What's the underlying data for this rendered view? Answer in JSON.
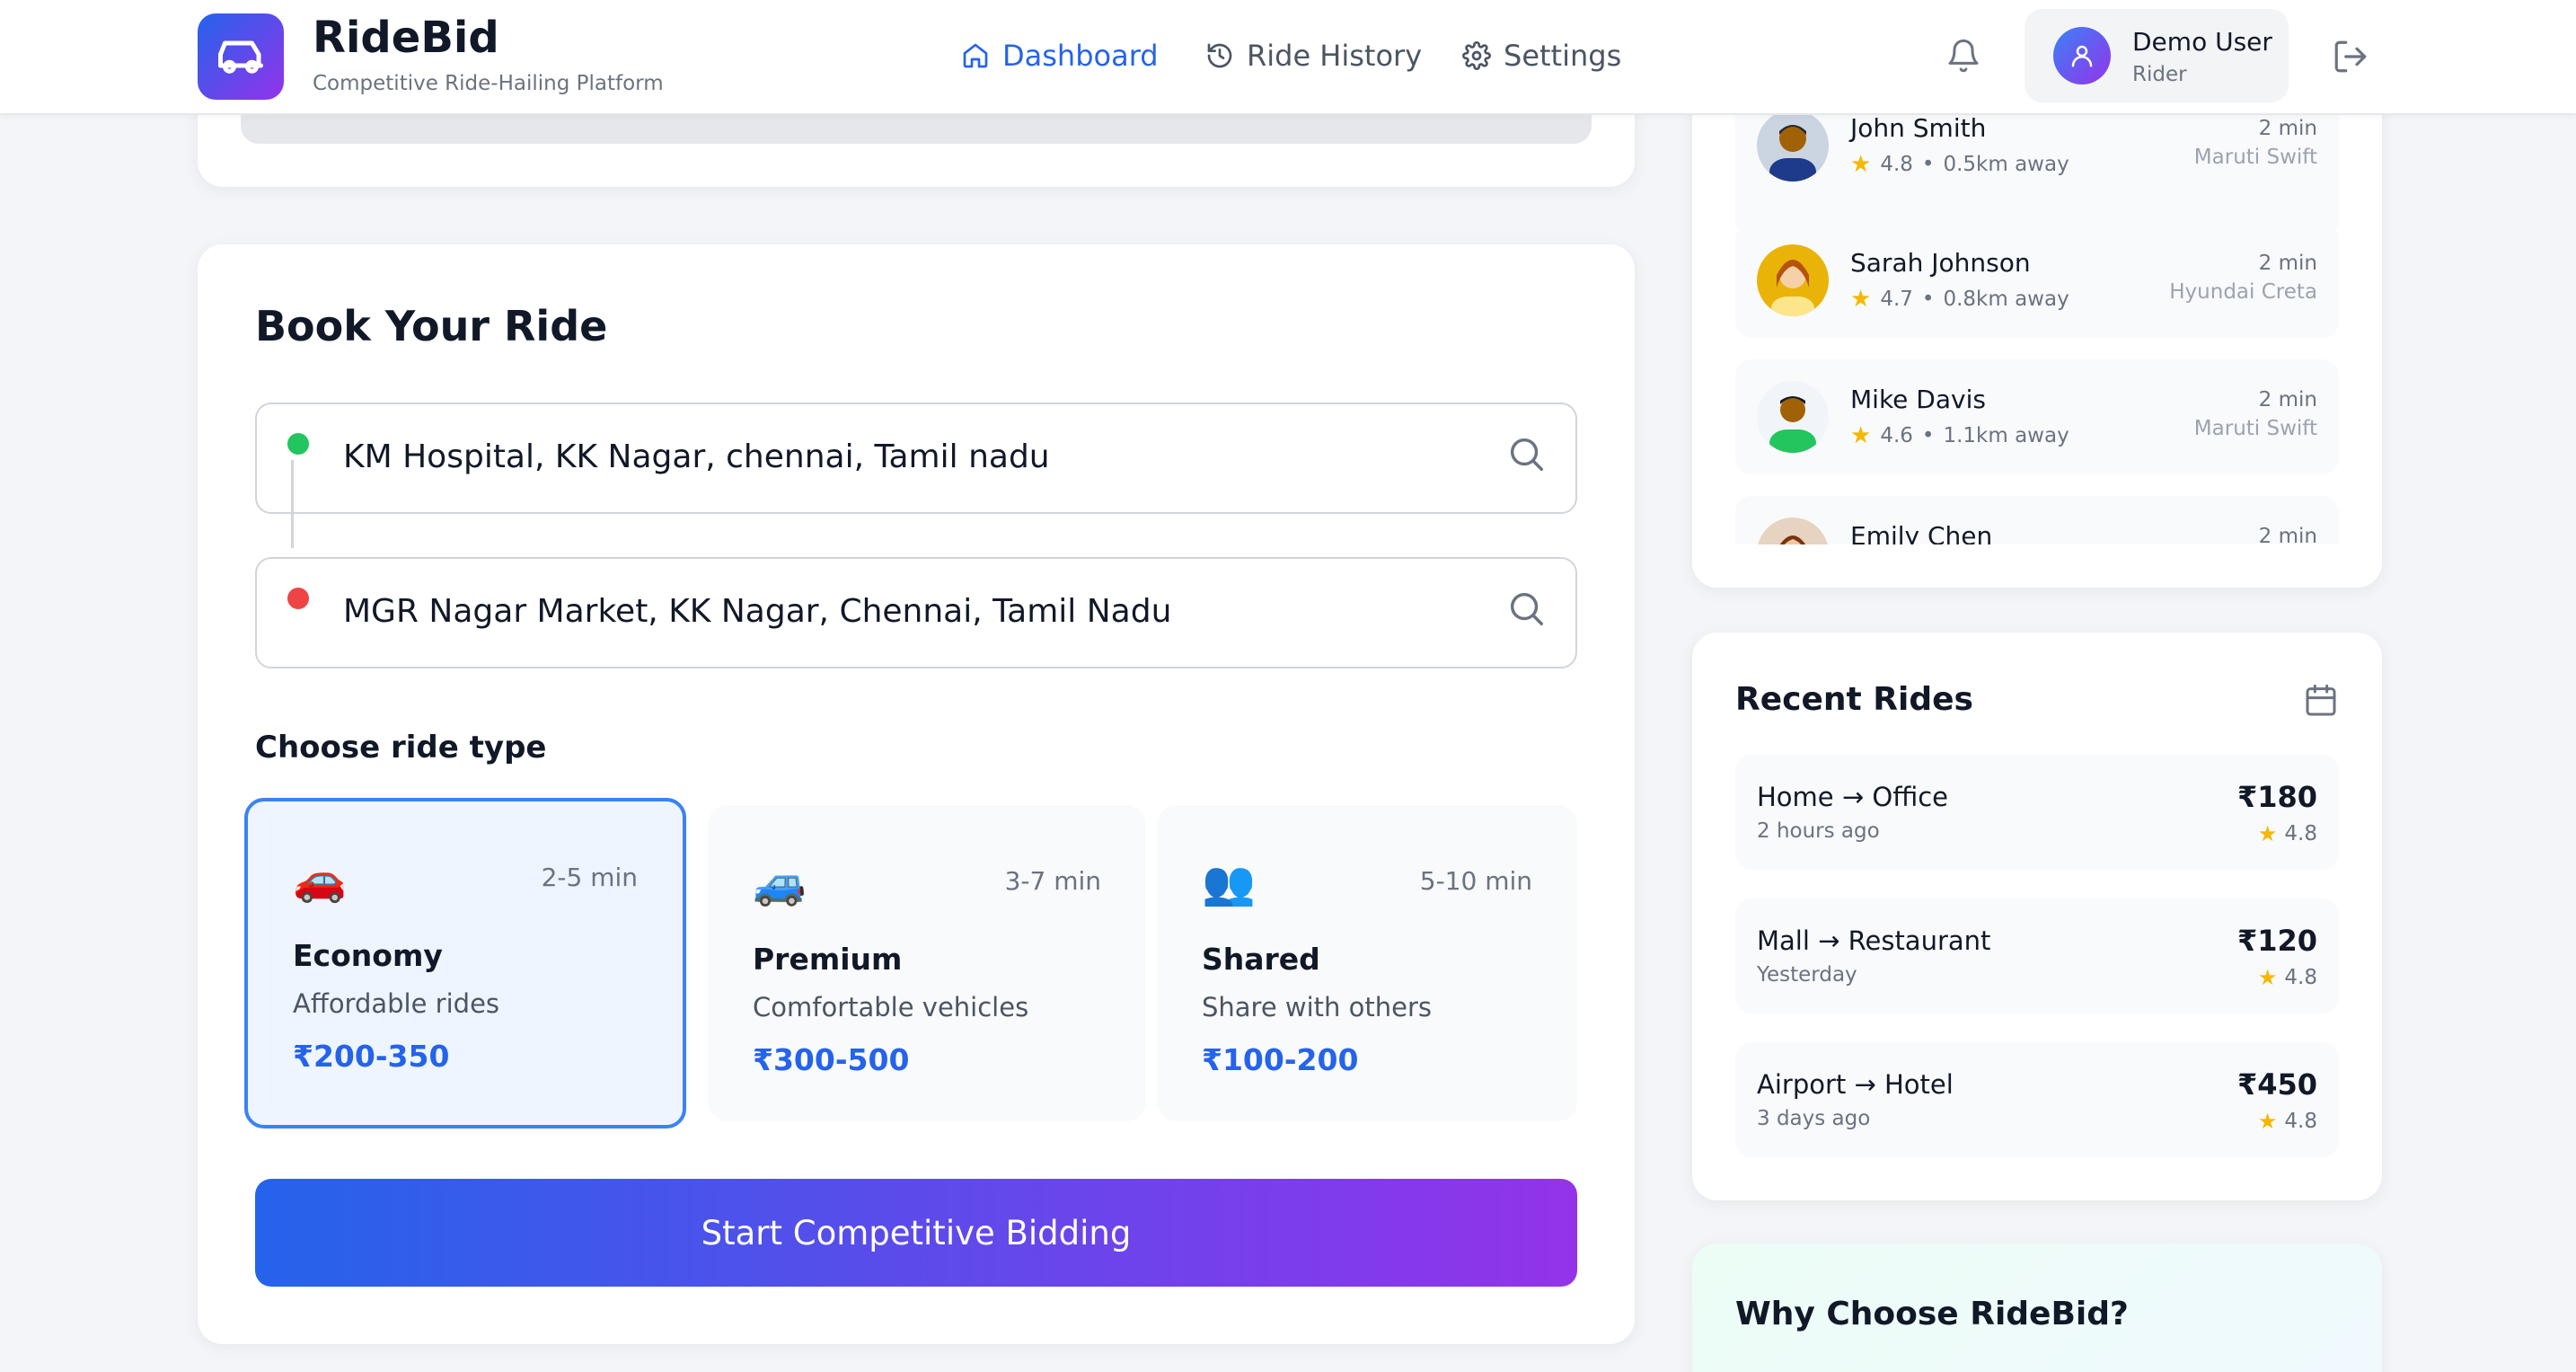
{
  "header": {
    "brand": "RideBid",
    "tagline": "Competitive Ride-Hailing Platform",
    "nav": [
      {
        "label": "Dashboard",
        "icon": "home-icon",
        "active": true
      },
      {
        "label": "Ride History",
        "icon": "history-icon",
        "active": false
      },
      {
        "label": "Settings",
        "icon": "gear-icon",
        "active": false
      }
    ],
    "user": {
      "name": "Demo User",
      "role": "Rider"
    }
  },
  "booking": {
    "title": "Book Your Ride",
    "pickup": "KM Hospital, KK Nagar, chennai, Tamil nadu",
    "dropoff": "MGR Nagar Market, KK Nagar, Chennai, Tamil Nadu",
    "ride_type_label": "Choose ride type",
    "options": [
      {
        "icon": "🚗",
        "eta": "2-5 min",
        "name": "Economy",
        "desc": "Affordable rides",
        "price": "₹200-350",
        "selected": true
      },
      {
        "icon": "🚙",
        "eta": "3-7 min",
        "name": "Premium",
        "desc": "Comfortable vehicles",
        "price": "₹300-500",
        "selected": false
      },
      {
        "icon": "👥",
        "eta": "5-10 min",
        "name": "Shared",
        "desc": "Share with others",
        "price": "₹100-200",
        "selected": false
      }
    ],
    "cta": "Start Competitive Bidding"
  },
  "drivers": [
    {
      "name": "John Smith",
      "rating": "4.8",
      "distance": "0.5km away",
      "eta": "2 min",
      "car": "Maruti Swift"
    },
    {
      "name": "Sarah Johnson",
      "rating": "4.7",
      "distance": "0.8km away",
      "eta": "2 min",
      "car": "Hyundai Creta"
    },
    {
      "name": "Mike Davis",
      "rating": "4.6",
      "distance": "1.1km away",
      "eta": "2 min",
      "car": "Maruti Swift"
    },
    {
      "name": "Emily Chen",
      "eta": "2 min"
    }
  ],
  "recent": {
    "title": "Recent Rides",
    "rides": [
      {
        "route": "Home → Office",
        "when": "2 hours ago",
        "amount": "₹180",
        "rating": "4.8"
      },
      {
        "route": "Mall → Restaurant",
        "when": "Yesterday",
        "amount": "₹120",
        "rating": "4.8"
      },
      {
        "route": "Airport → Hotel",
        "when": "3 days ago",
        "amount": "₹450",
        "rating": "4.8"
      }
    ]
  },
  "why": {
    "title": "Why Choose RideBid?"
  },
  "colors": {
    "primary": "#2563eb",
    "accent": "#9333ea",
    "pickup_dot": "#22c55e",
    "drop_dot": "#ef4444",
    "star": "#f5b800"
  }
}
